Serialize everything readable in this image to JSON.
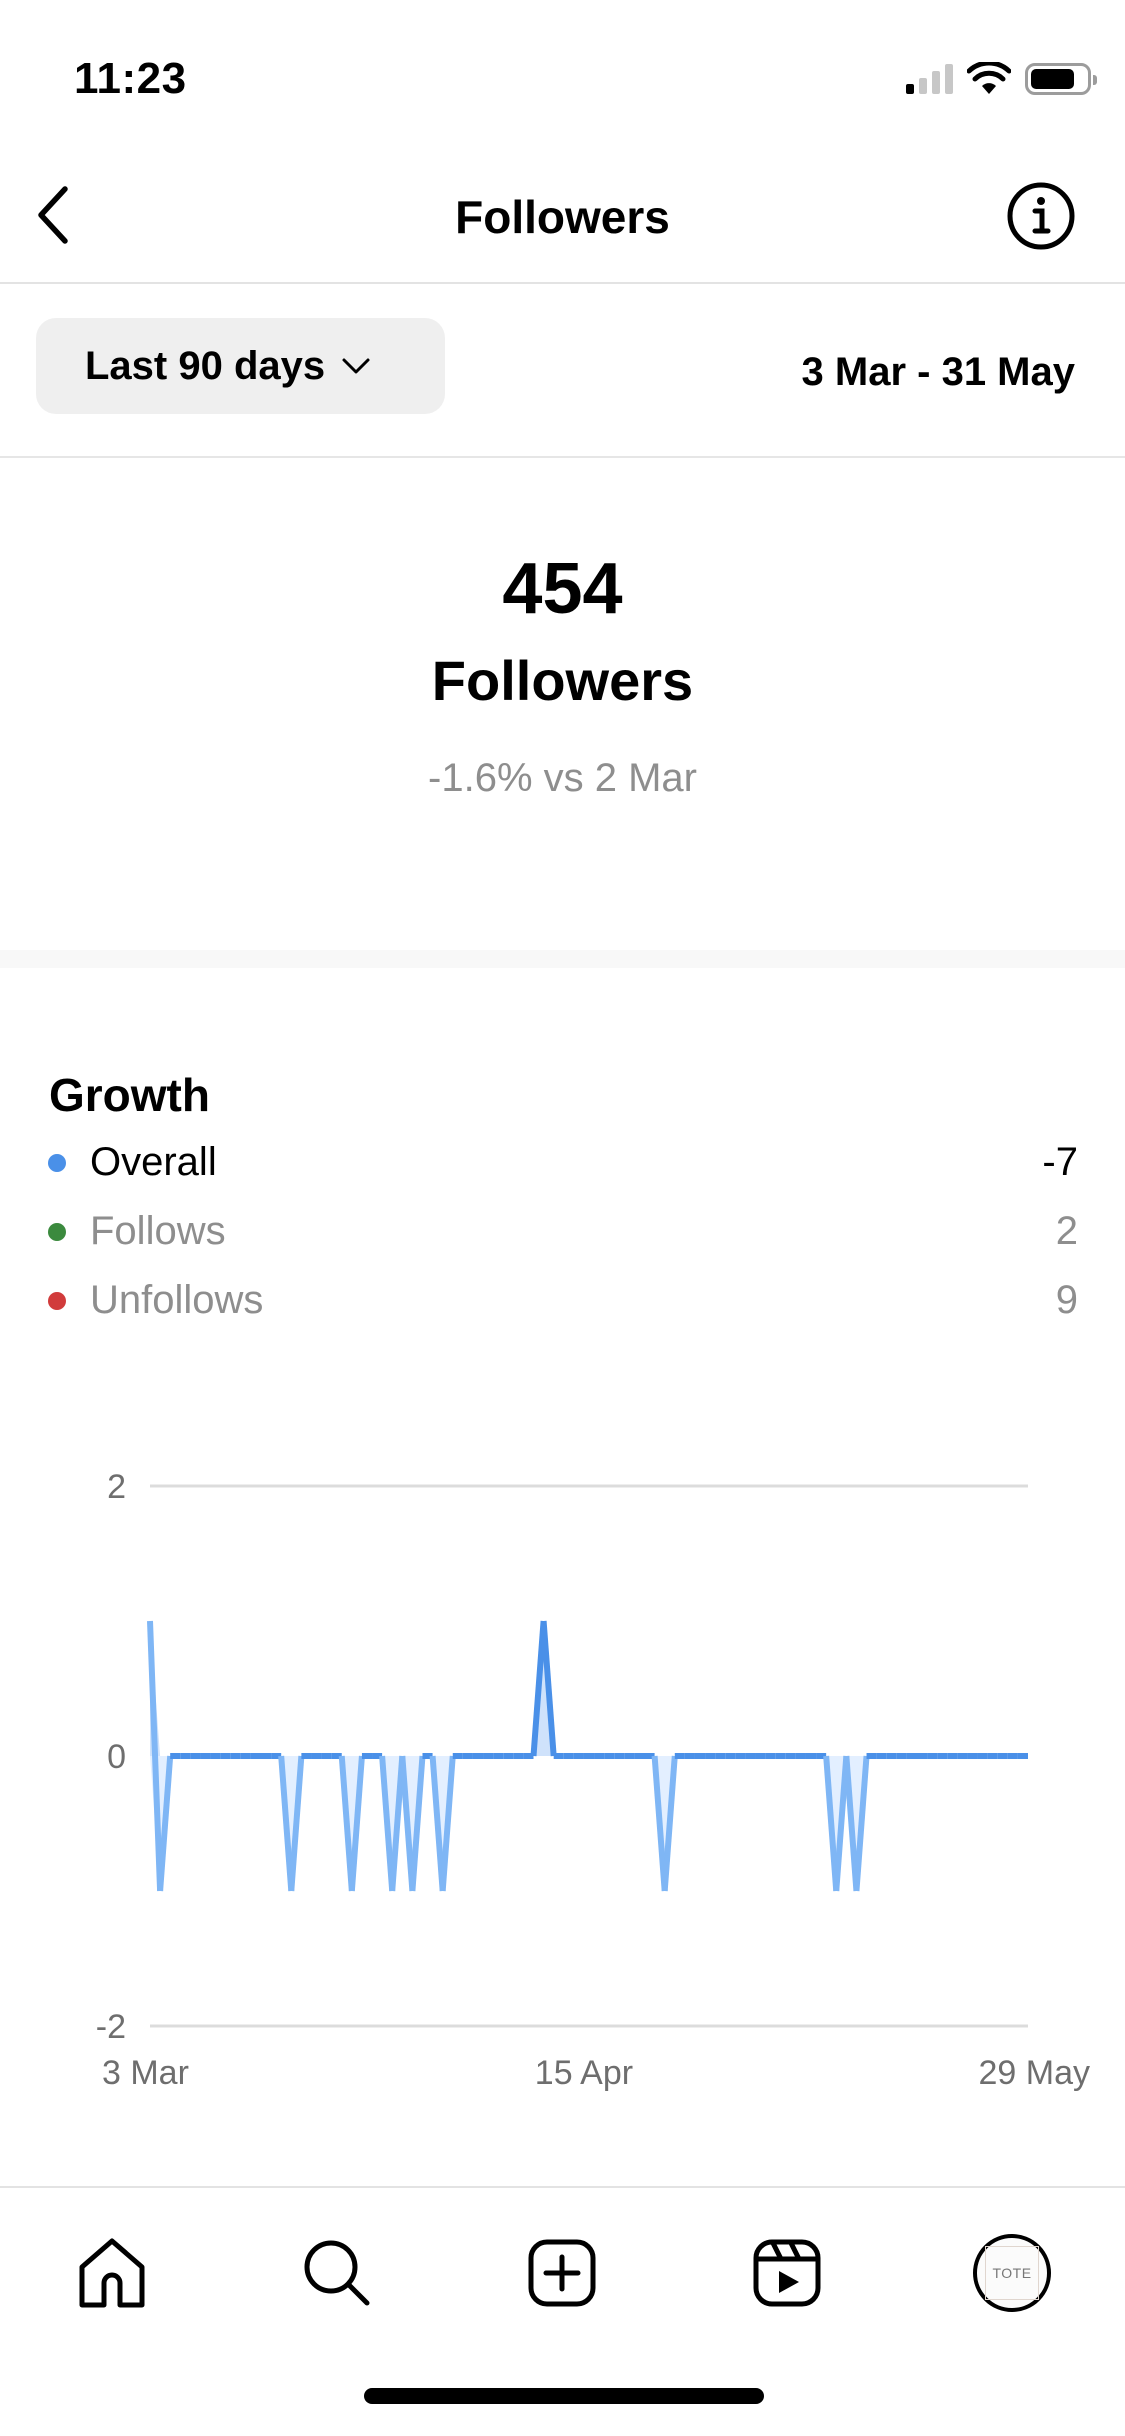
{
  "status_bar": {
    "time": "11:23",
    "signal_bars_on": 1,
    "signal_bars_total": 4,
    "battery_level": 0.8
  },
  "header": {
    "title": "Followers",
    "back_icon": "chevron-left-icon",
    "info_icon": "info-icon"
  },
  "filter": {
    "range_label": "Last 90 days",
    "range_icon": "chevron-down-icon",
    "date_range": "3 Mar - 31 May"
  },
  "summary": {
    "count": "454",
    "label": "Followers",
    "change": "-1.6% vs 2 Mar"
  },
  "growth": {
    "title": "Growth",
    "legend": [
      {
        "name": "Overall",
        "value": "-7",
        "color": "#4a90e8",
        "active": true
      },
      {
        "name": "Follows",
        "value": "2",
        "color": "#3b8a3e",
        "active": false
      },
      {
        "name": "Unfollows",
        "value": "9",
        "color": "#d13b3b",
        "active": false
      }
    ]
  },
  "chart_data": {
    "type": "line",
    "title": "Growth",
    "series_name": "Overall",
    "x_start": "3 Mar",
    "x_end": "29 May",
    "num_points": 88,
    "nonzero_points": [
      {
        "index": 0,
        "value": 1
      },
      {
        "index": 1,
        "value": -1
      },
      {
        "index": 14,
        "value": -1
      },
      {
        "index": 20,
        "value": -1
      },
      {
        "index": 24,
        "value": -1
      },
      {
        "index": 26,
        "value": -1
      },
      {
        "index": 29,
        "value": -1
      },
      {
        "index": 39,
        "value": 1
      },
      {
        "index": 51,
        "value": -1
      },
      {
        "index": 68,
        "value": -1
      },
      {
        "index": 70,
        "value": -1
      }
    ],
    "ylim": [
      -2,
      2
    ],
    "y_ticks": [
      "2",
      "0",
      "-2"
    ],
    "y_tick_values": [
      2,
      0,
      -2
    ],
    "x_ticks": [
      {
        "label": "3 Mar",
        "index": 0
      },
      {
        "label": "15 Apr",
        "index": 43
      },
      {
        "label": "29 May",
        "index": 87
      }
    ],
    "grid": true,
    "colors": {
      "line": "#4a90e8",
      "negative_line": "#7fb6f5",
      "negative_fill": "#e3efff",
      "grid": "#dcdcdc"
    }
  },
  "tab_bar": {
    "items": [
      {
        "name": "home",
        "icon": "home-icon"
      },
      {
        "name": "search",
        "icon": "search-icon"
      },
      {
        "name": "create",
        "icon": "plus-square-icon"
      },
      {
        "name": "reels",
        "icon": "reels-icon"
      },
      {
        "name": "profile",
        "icon": "avatar",
        "avatar_text": "TOTE"
      }
    ]
  }
}
